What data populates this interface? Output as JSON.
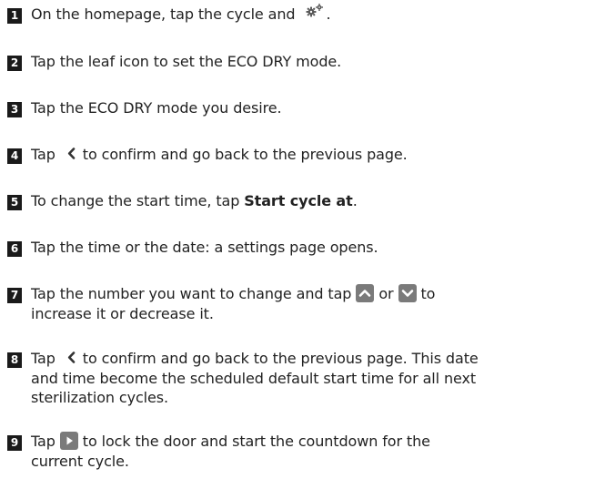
{
  "steps": [
    {
      "num": "1",
      "t1": "On the homepage, tap the cycle and ",
      "t2": "."
    },
    {
      "num": "2",
      "text": "Tap the leaf icon to set the ECO DRY mode."
    },
    {
      "num": "3",
      "text": "Tap the ECO DRY mode you desire."
    },
    {
      "num": "4",
      "t1": "Tap ",
      "t2": "to confirm and go back to the previous page."
    },
    {
      "num": "5",
      "t1": "To change the start time, tap ",
      "bold": "Start cycle at",
      "t2": "."
    },
    {
      "num": "6",
      "text": "Tap the time or the date: a settings page opens."
    },
    {
      "num": "7",
      "t1": "Tap the number you want to change and tap ",
      "t2": " or ",
      "t3": " to",
      "t4": "increase it or decrease it."
    },
    {
      "num": "8",
      "t1": "Tap ",
      "t2": "to confirm and go back to the previous page. This date",
      "t3": "and time become the scheduled default start time for all next",
      "t4": "sterilization cycles."
    },
    {
      "num": "9",
      "t1": "Tap ",
      "t2": " to lock the door and start the countdown for the",
      "t3": "current cycle."
    }
  ],
  "icons": {
    "settings": "gears-icon",
    "back": "chevron-left-icon",
    "up": "chevron-up-icon",
    "down": "chevron-down-icon",
    "play": "play-icon"
  },
  "colors": {
    "number_badge": "#1a1a1a",
    "icon_button": "#7a7a7a"
  }
}
